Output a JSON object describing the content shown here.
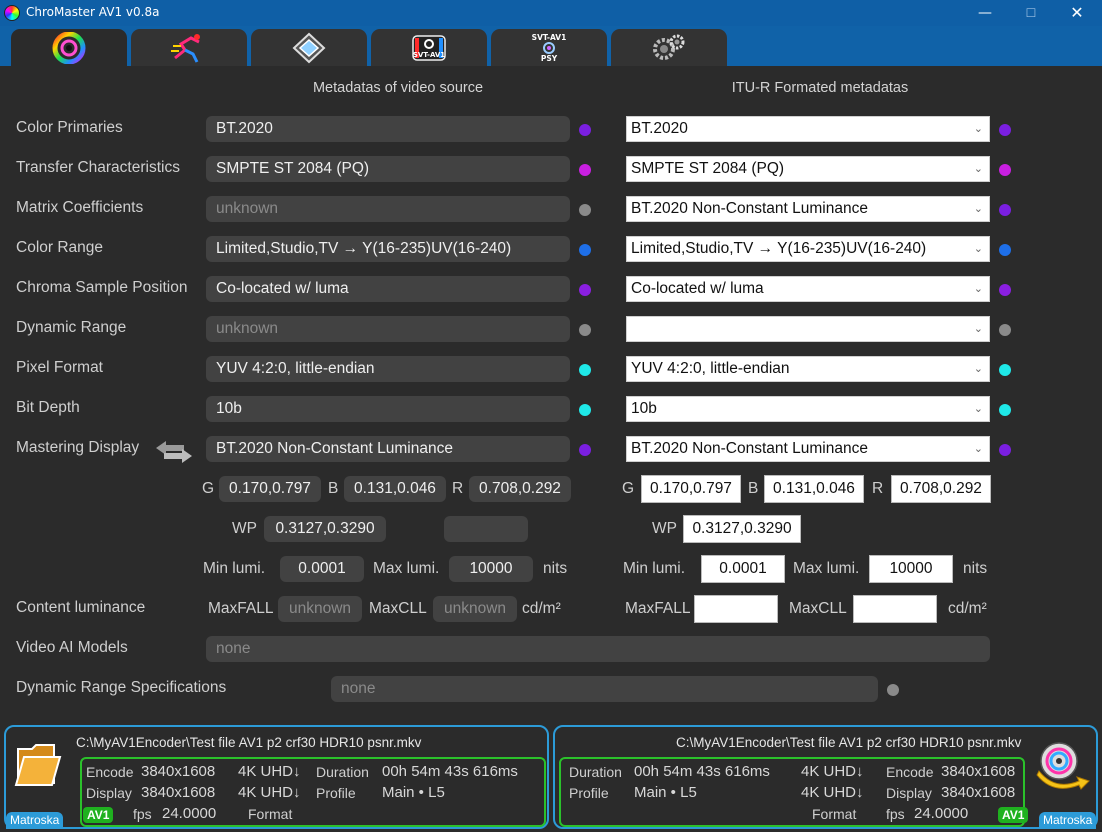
{
  "window": {
    "title": "ChroMaster AV1 v0.8a",
    "min_glyph": "—",
    "max_glyph": "☐",
    "close_glyph": "✕"
  },
  "tabs": [
    {
      "icon": "rainbow-ring-icon",
      "active": true
    },
    {
      "icon": "runner-icon"
    },
    {
      "icon": "diamond-icon"
    },
    {
      "icon": "svt-av1-logo-icon",
      "label": "SVT-AV1"
    },
    {
      "icon": "svt-av1-psy-logo-icon",
      "label_top": "SVT-AV1",
      "label_bottom": "PSY"
    },
    {
      "icon": "gears-icon"
    }
  ],
  "headers": {
    "source": "Metadatas of video source",
    "itu": "ITU-R Formated metadatas"
  },
  "rows": [
    {
      "label": "Color Primaries",
      "source": "BT.2020",
      "source_dim": false,
      "itu": "BT.2020",
      "color_src": "#7a1fe0",
      "color_itu": "#7a1fe0"
    },
    {
      "label": "Transfer Characteristics",
      "source": "SMPTE ST 2084 (PQ)",
      "source_dim": false,
      "itu": "SMPTE ST 2084 (PQ)",
      "color_src": "#c81fe0",
      "color_itu": "#c81fe0"
    },
    {
      "label": "Matrix Coefficients",
      "source": "unknown",
      "source_dim": true,
      "itu": "BT.2020 Non-Constant Luminance",
      "color_src": "#8a8a8a",
      "color_itu": "#7a1fe0"
    },
    {
      "label": "Color Range",
      "source": "Limited,Studio,TV → Y(16-235)UV(16-240)",
      "source_dim": false,
      "itu": "Limited,Studio,TV → Y(16-235)UV(16-240)",
      "color_src": "#1e6fe8",
      "color_itu": "#1e6fe8"
    },
    {
      "label": "Chroma Sample Position",
      "source": "Co-located w/ luma",
      "source_dim": false,
      "itu": "Co-located w/ luma",
      "color_src": "#8a1fe0",
      "color_itu": "#8a1fe0"
    },
    {
      "label": "Dynamic Range",
      "source": "unknown",
      "source_dim": true,
      "itu": "",
      "color_src": "#8a8a8a",
      "color_itu": "#8a8a8a"
    },
    {
      "label": "Pixel Format",
      "source": "YUV 4:2:0, little-endian",
      "source_dim": false,
      "itu": "YUV 4:2:0, little-endian",
      "color_src": "#1fe8e8",
      "color_itu": "#1fe8e8"
    },
    {
      "label": "Bit Depth",
      "source": "10b",
      "source_dim": false,
      "itu": "10b",
      "color_src": "#1fe8e8",
      "color_itu": "#1fe8e8"
    },
    {
      "label": "Mastering Display",
      "source": "BT.2020 Non-Constant Luminance",
      "source_dim": false,
      "itu": "BT.2020 Non-Constant Luminance",
      "color_src": "#7a1fe0",
      "color_itu": "#7a1fe0"
    }
  ],
  "mastering": {
    "g_label": "G",
    "b_label": "B",
    "r_label": "R",
    "wp_label": "WP",
    "src": {
      "g": "0.170,0.797",
      "b": "0.131,0.046",
      "r": "0.708,0.292",
      "wp": "0.3127,0.3290",
      "extra": ""
    },
    "itu": {
      "g": "0.170,0.797",
      "b": "0.131,0.046",
      "r": "0.708,0.292",
      "wp": "0.3127,0.3290"
    },
    "min_label": "Min lumi.",
    "max_label": "Max lumi.",
    "nits": "nits",
    "src_min": "0.0001",
    "src_max": "10000",
    "itu_min": "0.0001",
    "itu_max": "10000"
  },
  "content_luminance": {
    "label": "Content luminance",
    "maxfall_label": "MaxFALL",
    "maxcll_label": "MaxCLL",
    "unit": "cd/m²",
    "src_maxfall": "unknown",
    "src_maxcll": "unknown",
    "itu_maxfall": "",
    "itu_maxcll": ""
  },
  "video_ai": {
    "label": "Video AI Models",
    "value": "none"
  },
  "dynamic_spec": {
    "label": "Dynamic Range Specifications",
    "value": "none",
    "color": "#8a8a8a"
  },
  "left_panel": {
    "path": "C:\\MyAV1Encoder\\Test file AV1 p2 crf30 HDR10 psnr.mkv",
    "encode_label": "Encode",
    "encode_value": "3840x1608",
    "encode_class": "4K UHD↓",
    "display_label": "Display",
    "display_value": "3840x1608",
    "display_class": "4K UHD↓",
    "fps_label": "fps",
    "fps_value": "24.0000",
    "duration_label": "Duration",
    "duration_value": "00h 54m 43s 616ms",
    "profile_label": "Profile",
    "profile_value": "Main • L5",
    "format_label": "Format",
    "codec_badge": "AV1",
    "container": "Matroska",
    "icon": "folder-icon"
  },
  "right_panel": {
    "path": "C:\\MyAV1Encoder\\Test file AV1 p2 crf30 HDR10 psnr.mkv",
    "duration_label": "Duration",
    "duration_value": "00h 54m 43s 616ms",
    "duration_class": "4K UHD↓",
    "profile_label": "Profile",
    "profile_value": "Main • L5",
    "profile_class": "4K UHD↓",
    "encode_label": "Encode",
    "encode_value": "3840x1608",
    "display_label": "Display",
    "display_value": "3840x1608",
    "format_label": "Format",
    "fps_label": "fps",
    "fps_value": "24.0000",
    "codec_badge": "AV1",
    "container": "Matroska",
    "icon": "disc-output-icon"
  },
  "swap_icon": "swap-arrows-icon"
}
